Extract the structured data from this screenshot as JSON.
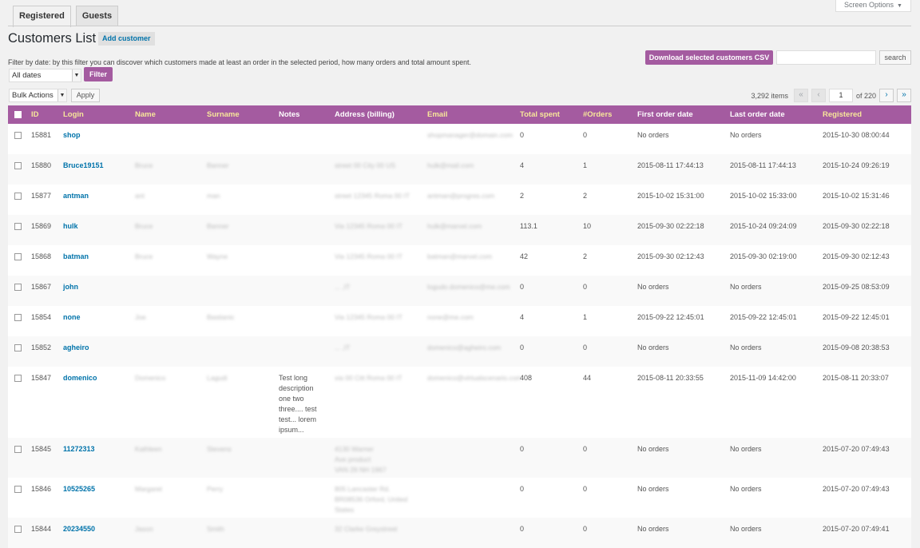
{
  "screen_options": "Screen Options",
  "tabs": [
    {
      "label": "Registered",
      "active": true
    },
    {
      "label": "Guests",
      "active": false
    }
  ],
  "page_title": "Customers List",
  "add_customer_label": "Add customer",
  "filter": {
    "description": "Filter by date: by this filter you can discover which customers made at least an order in the selected period, how many orders and total amount spent.",
    "date_selected": "All dates",
    "button_label": "Filter"
  },
  "csv_button_label": "Download selected customers CSV",
  "search": {
    "placeholder": "",
    "button_label": "search"
  },
  "bulk": {
    "selected": "Bulk Actions",
    "apply_label": "Apply"
  },
  "pagination": {
    "items": "3,292 items",
    "first": "«",
    "prev": "‹",
    "next": "›",
    "last": "»",
    "current_page": "1",
    "of_total": "of 220"
  },
  "columns": [
    "ID",
    "Login",
    "Name",
    "Surname",
    "Notes",
    "Address (billing)",
    "Email",
    "Total spent",
    "#Orders",
    "First order date",
    "Last order date",
    "Registered"
  ],
  "rows": [
    {
      "id": "15881",
      "login": "shop",
      "name": "",
      "surname": "",
      "notes": "",
      "address": "",
      "email": "shopmanager@domain.com",
      "total": "0",
      "orders": "0",
      "first": "No orders",
      "last": "No orders",
      "registered": "2015-10-30 08:00:44"
    },
    {
      "id": "15880",
      "login": "Bruce19151",
      "name": "Bruce",
      "surname": "Banner",
      "notes": "",
      "address": "street 00 City 00 US",
      "email": "hulk@mail.com",
      "total": "4",
      "orders": "1",
      "first": "2015-08-11 17:44:13",
      "last": "2015-08-11 17:44:13",
      "registered": "2015-10-24 09:26:19"
    },
    {
      "id": "15877",
      "login": "antman",
      "name": "ant",
      "surname": "man",
      "notes": "",
      "address": "street 12345 Roma 00 IT",
      "email": "antman@progres.com",
      "total": "2",
      "orders": "2",
      "first": "2015-10-02 15:31:00",
      "last": "2015-10-02 15:33:00",
      "registered": "2015-10-02 15:31:46"
    },
    {
      "id": "15869",
      "login": "hulk",
      "name": "Bruce",
      "surname": "Banner",
      "notes": "",
      "address": "Via 12345 Roma 00 IT",
      "email": "hulk@marvel.com",
      "total": "113.1",
      "orders": "10",
      "first": "2015-09-30 02:22:18",
      "last": "2015-10-24 09:24:09",
      "registered": "2015-09-30 02:22:18"
    },
    {
      "id": "15868",
      "login": "batman",
      "name": "Bruce",
      "surname": "Wayne",
      "notes": "",
      "address": "Via 12345 Roma 00 IT",
      "email": "batman@marvel.com",
      "total": "42",
      "orders": "2",
      "first": "2015-09-30 02:12:43",
      "last": "2015-09-30 02:19:00",
      "registered": "2015-09-30 02:12:43"
    },
    {
      "id": "15867",
      "login": "john",
      "name": "",
      "surname": "",
      "notes": "",
      "address": "... ,IT",
      "email": "logudo.domenico@me.com",
      "total": "0",
      "orders": "0",
      "first": "No orders",
      "last": "No orders",
      "registered": "2015-09-25 08:53:09"
    },
    {
      "id": "15854",
      "login": "none",
      "name": "Joe",
      "surname": "Bastianic",
      "notes": "",
      "address": "Via 12345 Roma 00 IT",
      "email": "none@me.com",
      "total": "4",
      "orders": "1",
      "first": "2015-09-22 12:45:01",
      "last": "2015-09-22 12:45:01",
      "registered": "2015-09-22 12:45:01"
    },
    {
      "id": "15852",
      "login": "agheiro",
      "name": "",
      "surname": "",
      "notes": "",
      "address": "... ,IT",
      "email": "domenico@agheiro.com",
      "total": "0",
      "orders": "0",
      "first": "No orders",
      "last": "No orders",
      "registered": "2015-09-08 20:38:53"
    },
    {
      "id": "15847",
      "login": "domenico",
      "name": "Domenico",
      "surname": "Lagudi",
      "notes": "Test long\ndescription\none two\nthree.... test\ntest... lorem\nipsum...",
      "address": "via 00 Citt Roma 00 IT",
      "email": "domenico@virtualscenario.com",
      "total": "408",
      "orders": "44",
      "first": "2015-08-11 20:33:55",
      "last": "2015-11-09 14:42:00",
      "registered": "2015-08-11 20:33:07"
    },
    {
      "id": "15845",
      "login": "11272313",
      "name": "Kathleen",
      "surname": "Stevens",
      "notes": "",
      "address": "4130 Warner\nAve product\nVAN 29 NH 1967",
      "email": "",
      "total": "0",
      "orders": "0",
      "first": "No orders",
      "last": "No orders",
      "registered": "2015-07-20 07:49:43"
    },
    {
      "id": "15846",
      "login": "10525265",
      "name": "Margaret",
      "surname": "Perry",
      "notes": "",
      "address": "805 Lancaster Rd.\nBR08536 Orford, United\nStates",
      "email": "",
      "total": "0",
      "orders": "0",
      "first": "No orders",
      "last": "No orders",
      "registered": "2015-07-20 07:49:43"
    },
    {
      "id": "15844",
      "login": "20234550",
      "name": "Jason",
      "surname": "Smith",
      "notes": "",
      "address": "32 Clarke Greystreet",
      "email": "",
      "total": "0",
      "orders": "0",
      "first": "No orders",
      "last": "No orders",
      "registered": "2015-07-20 07:49:41"
    }
  ]
}
